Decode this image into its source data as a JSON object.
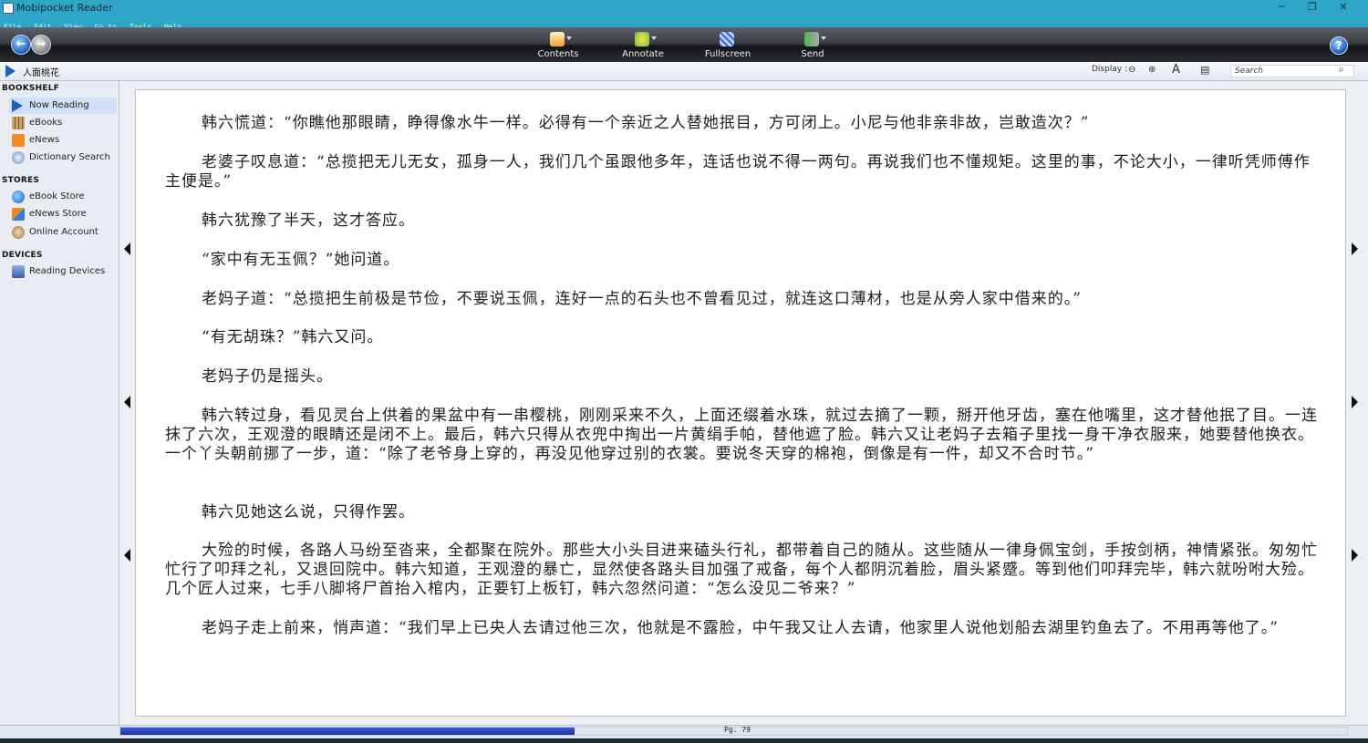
{
  "window": {
    "title": "Mobipocket Reader",
    "controls": [
      "─",
      "❐",
      "✕"
    ]
  },
  "menu": [
    "File",
    "Edit",
    "View",
    "Go to",
    "Tools",
    "Help"
  ],
  "toolbar": {
    "buttons": [
      {
        "label": "Contents",
        "icon": "home-icon"
      },
      {
        "label": "Annotate",
        "icon": "annotate-icon"
      },
      {
        "label": "Fullscreen",
        "icon": "fullscreen-icon"
      },
      {
        "label": "Send",
        "icon": "send-icon"
      }
    ],
    "help": "?"
  },
  "book": {
    "title": "人面桃花"
  },
  "display": {
    "label": "Display :",
    "font": "A"
  },
  "search": {
    "placeholder": "Search"
  },
  "sidebar": {
    "bookshelf_label": "BOOKSHELF",
    "bookshelf": [
      "Now Reading",
      "eBooks",
      "eNews",
      "Dictionary Search"
    ],
    "stores_label": "STORES",
    "stores": [
      "eBook Store",
      "eNews Store",
      "Online Account"
    ],
    "devices_label": "DEVICES",
    "devices": [
      "Reading Devices"
    ]
  },
  "content": {
    "paragraphs": [
      "韩六慌道：“你瞧他那眼睛，睁得像水牛一样。必得有一个亲近之人替她抿目，方可闭上。小尼与他非亲非故，岂敢造次？”",
      "老婆子叹息道：“总揽把无儿无女，孤身一人，我们几个虽跟他多年，连话也说不得一两句。再说我们也不懂规矩。这里的事，不论大小，一律听凭师傅作主便是。”",
      "韩六犹豫了半天，这才答应。",
      "“家中有无玉佩？”她问道。",
      "老妈子道：“总揽把生前极是节俭，不要说玉佩，连好一点的石头也不曾看见过，就连这口薄材，也是从旁人家中借来的。”",
      "“有无胡珠？”韩六又问。",
      "老妈子仍是摇头。",
      "韩六转过身，看见灵台上供着的果盆中有一串樱桃，刚刚采来不久，上面还缀着水珠，就过去摘了一颗，掰开他牙齿，塞在他嘴里，这才替他抿了目。一连抹了六次，王观澄的眼睛还是闭不上。最后，韩六只得从衣兜中掏出一片黄绢手帕，替他遮了脸。韩六又让老妈子去箱子里找一身干净衣服来，她要替他换衣。一个丫头朝前挪了一步，道：“除了老爷身上穿的，再没见他穿过别的衣裳。要说冬天穿的棉袍，倒像是有一件，却又不合时节。”",
      "韩六见她这么说，只得作罢。",
      "大殓的时候，各路人马纷至沓来，全都聚在院外。那些大小头目进来磕头行礼，都带着自己的随从。这些随从一律身佩宝剑，手按剑柄，神情紧张。匆匆忙忙行了叩拜之礼，又退回院中。韩六知道，王观澄的暴亡，显然使各路头目加强了戒备，每个人都阴沉着脸，眉头紧蹙。等到他们叩拜完毕，韩六就吩咐大殓。几个匠人过来，七手八脚将尸首抬入棺内，正要钉上板钉，韩六忽然问道：“怎么没见二爷来？”",
      "老妈子走上前来，悄声道：“我们早上已央人去请过他三次，他就是不露脸，中午我又让人去请，他家里人说他划船去湖里钓鱼去了。不用再等他了。”"
    ]
  },
  "status": {
    "page": "Pg. 79",
    "progress": 0.37
  }
}
